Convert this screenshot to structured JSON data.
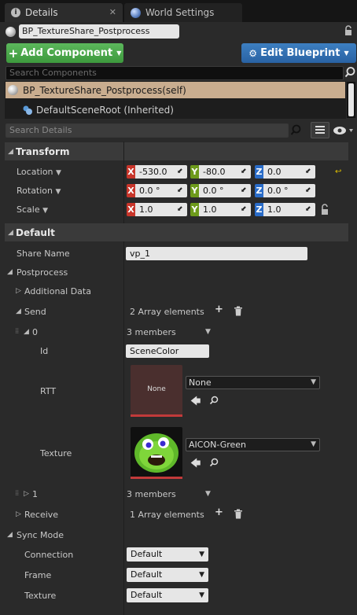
{
  "tabs": [
    {
      "label": "Details",
      "icon": "info-icon"
    },
    {
      "label": "World Settings",
      "icon": "globe-icon"
    }
  ],
  "actor_name": "BP_TextureShare_Postprocess",
  "toolbar": {
    "add_component_label": "Add Component",
    "edit_blueprint_label": "Edit Blueprint"
  },
  "search_components_placeholder": "Search Components",
  "components": {
    "self": "BP_TextureShare_Postprocess(self)",
    "root": "DefaultSceneRoot (Inherited)"
  },
  "search_details_placeholder": "Search Details",
  "transform": {
    "header": "Transform",
    "location_label": "Location",
    "rotation_label": "Rotation",
    "scale_label": "Scale",
    "location": {
      "x": "-530.0",
      "y": "-80.0",
      "z": "0.0"
    },
    "rotation": {
      "x": "0.0 °",
      "y": "0.0 °",
      "z": "0.0 °"
    },
    "scale": {
      "x": "1.0",
      "y": "1.0",
      "z": "1.0"
    }
  },
  "axes": {
    "x": "X",
    "y": "Y",
    "z": "Z"
  },
  "default_section": {
    "header": "Default",
    "share_name_label": "Share Name",
    "share_name_value": "vp_1",
    "postprocess_label": "Postprocess",
    "additional_data_label": "Additional Data",
    "send_label": "Send",
    "send_count": "2 Array elements",
    "item0_label": "0",
    "item0_members": "3 members",
    "id_label": "Id",
    "id_value": "SceneColor",
    "rtt_label": "RTT",
    "rtt_thumb_text": "None",
    "rtt_value": "None",
    "texture_label": "Texture",
    "texture_value": "AICON-Green",
    "item1_label": "1",
    "item1_members": "3 members",
    "receive_label": "Receive",
    "receive_count": "1 Array elements",
    "sync_mode_label": "Sync Mode",
    "connection_label": "Connection",
    "connection_value": "Default",
    "frame_label": "Frame",
    "frame_value": "Default",
    "sync_texture_label": "Texture",
    "sync_texture_value": "Default"
  },
  "colors": {
    "add_button": "#4aa84a",
    "edit_blueprint_button": "#2f6fb3",
    "selected_component": "#c9ad8f",
    "axis_x": "#c8352a",
    "axis_y": "#6d9a1b",
    "axis_z": "#2a6cc8"
  }
}
